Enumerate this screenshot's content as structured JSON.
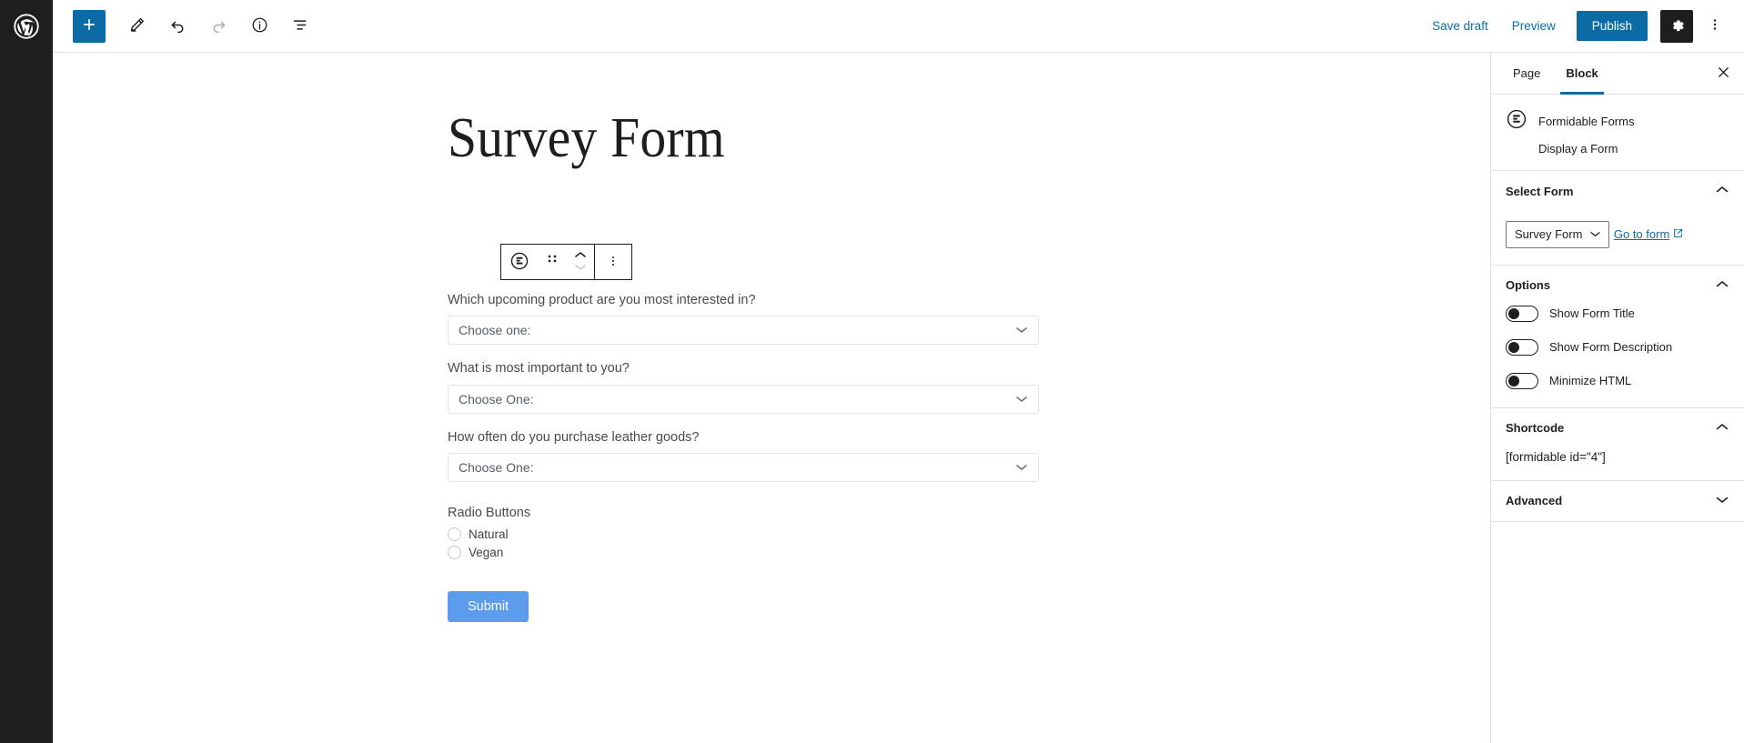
{
  "topbar": {
    "logo_icon": "wordpress-logo-icon",
    "tools": [
      {
        "name": "add-block-button",
        "icon": "plus-icon",
        "state": "primary"
      },
      {
        "name": "tools-button",
        "icon": "pencil-icon",
        "state": "default"
      },
      {
        "name": "undo-button",
        "icon": "undo-arrow-icon",
        "state": "default"
      },
      {
        "name": "redo-button",
        "icon": "redo-arrow-icon",
        "state": "disabled"
      },
      {
        "name": "details-button",
        "icon": "info-circle-icon",
        "state": "default"
      },
      {
        "name": "list-view-button",
        "icon": "list-view-icon",
        "state": "default"
      }
    ],
    "save_draft_label": "Save draft",
    "preview_label": "Preview",
    "publish_label": "Publish",
    "settings_icon": "gear-icon",
    "more_icon": "ellipsis-vertical-icon",
    "accent_color": "#0b6ca5",
    "dark_color": "#1e1e1e"
  },
  "editor": {
    "post_title": "Survey Form",
    "block_toolbar": {
      "block_type_icon": "formidable-forms-icon",
      "drag_handle_icon": "drag-dots-icon",
      "move_up_icon": "chevron-up-icon",
      "move_down_icon": "chevron-down-icon",
      "options_icon": "ellipsis-vertical-icon"
    },
    "form": {
      "fields": [
        {
          "label": "Which upcoming product are you most interested in?",
          "value": "Choose one:",
          "type": "select"
        },
        {
          "label": "What is most important to you?",
          "value": "Choose One:",
          "type": "select"
        },
        {
          "label": "How often do you purchase leather goods?",
          "value": "Choose One:",
          "type": "select"
        }
      ],
      "radio_group": {
        "label": "Radio Buttons",
        "options": [
          {
            "label": "Natural",
            "selected": false
          },
          {
            "label": "Vegan",
            "selected": false
          }
        ]
      },
      "submit_label": "Submit",
      "submit_color": "#5d9cec"
    }
  },
  "sidebar": {
    "tabs": [
      {
        "label": "Page",
        "active": false
      },
      {
        "label": "Block",
        "active": true
      }
    ],
    "close_icon": "close-icon",
    "block_card": {
      "icon": "formidable-forms-icon",
      "title": "Formidable Forms",
      "description": "Display a Form"
    },
    "panels": [
      {
        "name": "select-form",
        "title": "Select Form",
        "expanded": true,
        "chevron_icon": "chevron-up-icon",
        "select_value": "Survey Form",
        "select_chevron_icon": "chevron-down-icon",
        "link_label": "Go to form",
        "link_icon": "external-link-icon"
      },
      {
        "name": "options",
        "title": "Options",
        "expanded": true,
        "chevron_icon": "chevron-up-icon",
        "toggles": [
          {
            "label": "Show Form Title",
            "on": false
          },
          {
            "label": "Show Form Description",
            "on": false
          },
          {
            "label": "Minimize HTML",
            "on": false
          }
        ]
      },
      {
        "name": "shortcode",
        "title": "Shortcode",
        "expanded": true,
        "chevron_icon": "chevron-up-icon",
        "value": "[formidable id=\"4\"]"
      },
      {
        "name": "advanced",
        "title": "Advanced",
        "expanded": false,
        "chevron_icon": "chevron-down-icon"
      }
    ]
  }
}
